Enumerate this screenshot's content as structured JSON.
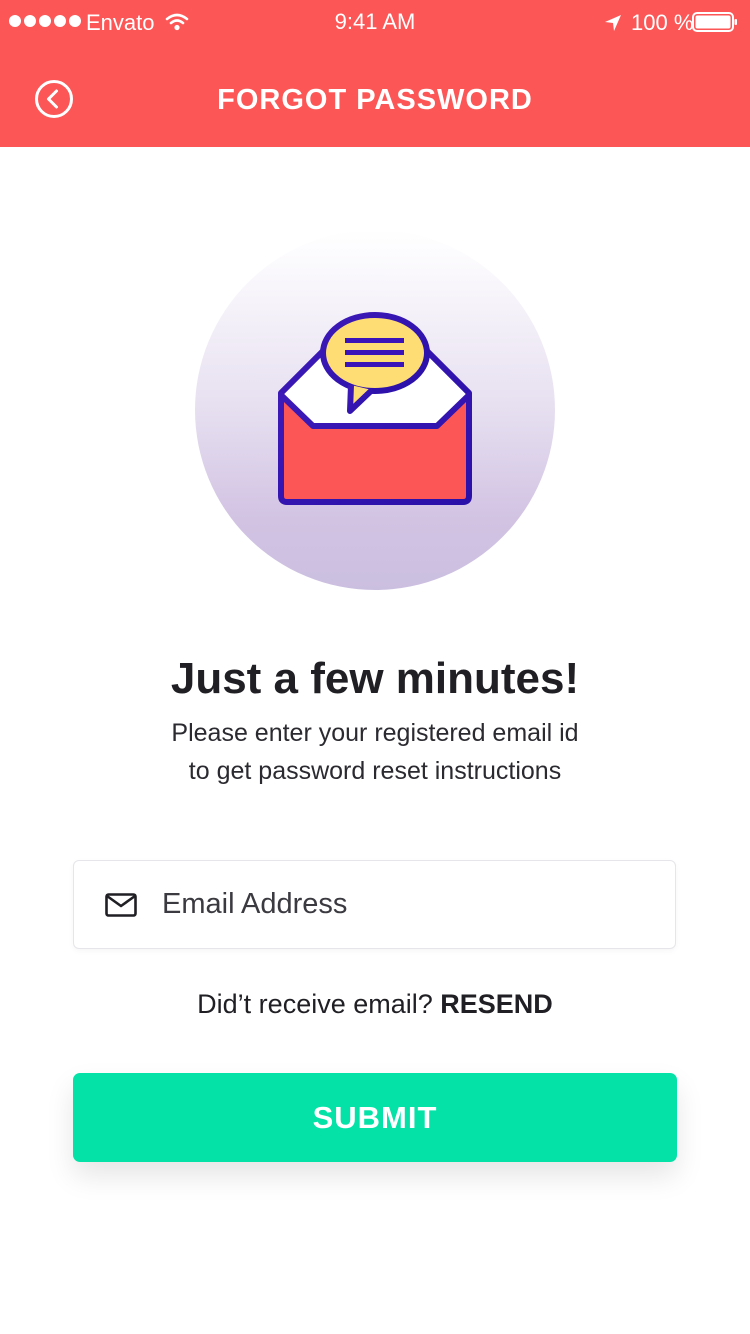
{
  "status_bar": {
    "carrier": "Envato",
    "time": "9:41 AM",
    "battery": "100 %",
    "signal_icon": "signal-dots-icon",
    "wifi_icon": "wifi-icon",
    "location_icon": "location-arrow-icon",
    "battery_icon": "battery-icon"
  },
  "header": {
    "title": "FORGOT PASSWORD",
    "back_icon": "chevron-left-circle-icon"
  },
  "illustration": {
    "icon": "open-envelope-with-message-bubble-icon"
  },
  "main": {
    "headline": "Just a few minutes!",
    "description_line1": "Please enter your registered email id",
    "description_line2": "to get password reset instructions"
  },
  "form": {
    "email_placeholder": "Email Address",
    "email_value": "",
    "email_icon": "mail-icon",
    "resend_prompt": "Did’t receive email?",
    "resend_link": "RESEND",
    "submit_label": "SUBMIT"
  },
  "colors": {
    "header_bg": "#fd5656",
    "submit_bg": "#04e2a8",
    "envelope_fill": "#fd5656",
    "envelope_stroke": "#3a14b8",
    "bubble_fill": "#fedd74"
  }
}
